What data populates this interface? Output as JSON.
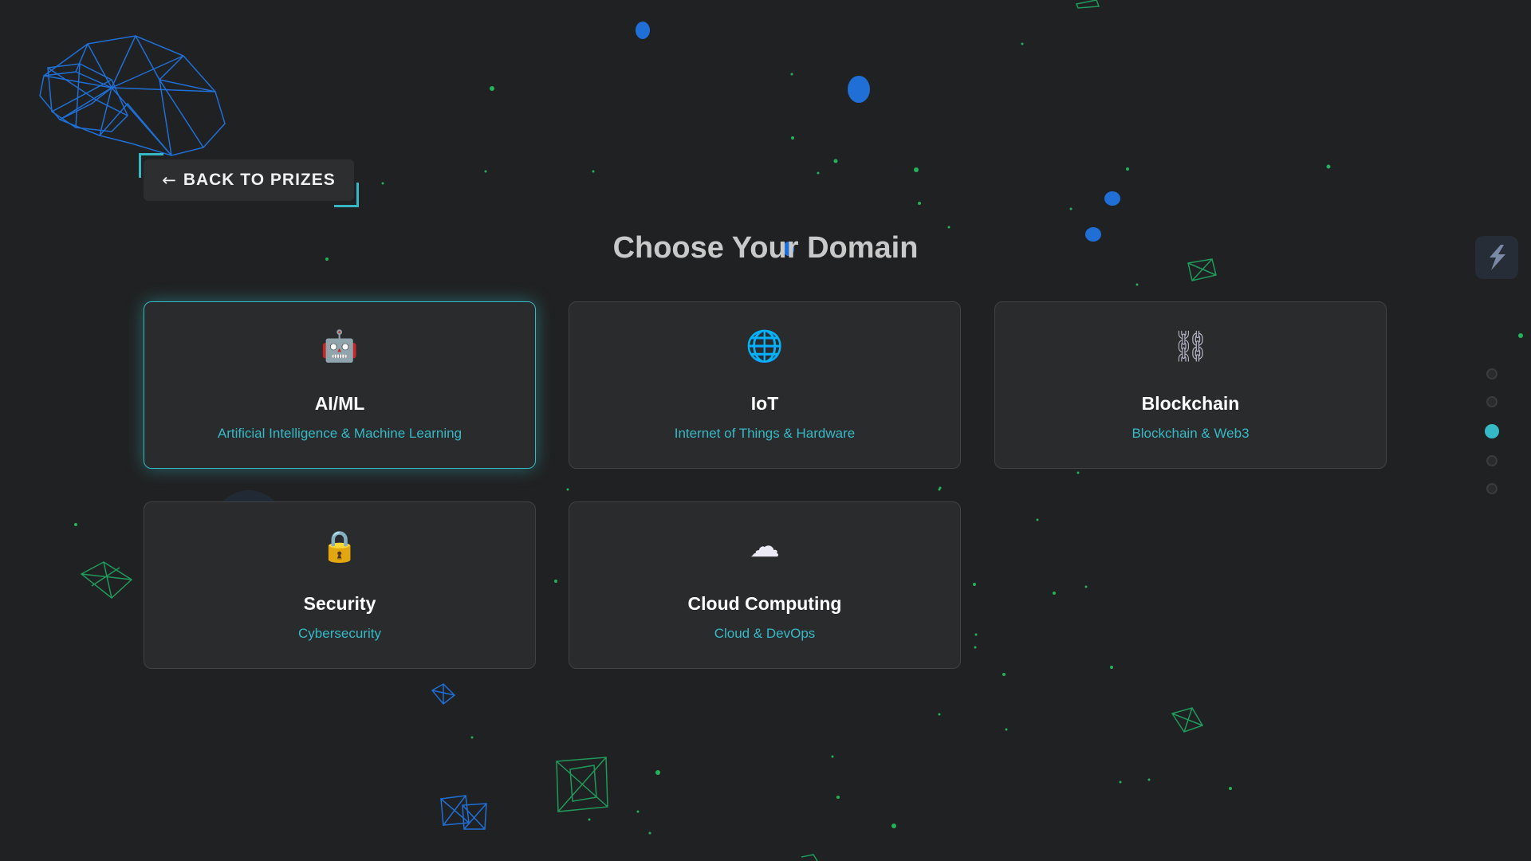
{
  "back_button": {
    "arrow": "←",
    "label": "BACK TO PRIZES"
  },
  "page_title": "Choose Your Domain",
  "domains": [
    {
      "icon": "robot-icon",
      "glyph": "🤖",
      "name": "AI/ML",
      "description": "Artificial Intelligence & Machine Learning",
      "selected": true
    },
    {
      "icon": "globe-icon",
      "glyph": "🌐",
      "name": "IoT",
      "description": "Internet of Things & Hardware",
      "selected": false
    },
    {
      "icon": "chain-link-icon",
      "glyph": "⛓",
      "name": "Blockchain",
      "description": "Blockchain & Web3",
      "selected": false
    },
    {
      "icon": "lock-icon",
      "glyph": "🔒",
      "name": "Security",
      "description": "Cybersecurity",
      "selected": false
    },
    {
      "icon": "cloud-icon",
      "glyph": "☁",
      "name": "Cloud Computing",
      "description": "Cloud & DevOps",
      "selected": false
    }
  ],
  "section_nav": {
    "count": 5,
    "active_index": 2
  },
  "colors": {
    "background": "#202122",
    "accent": "#36b9c6",
    "card": "#2a2b2c",
    "wireframe_blue": "#1f6fd6",
    "wireframe_green": "#1f9a5c",
    "star_green": "#22b35a"
  }
}
